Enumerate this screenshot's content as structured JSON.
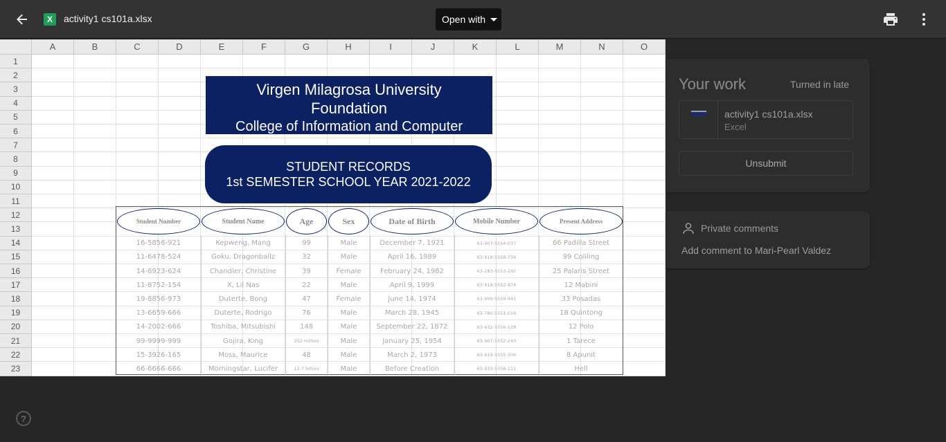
{
  "topbar": {
    "filename": "activity1 cs101a.xlsx",
    "file_badge": "X",
    "open_with_label": "Open with"
  },
  "sheet": {
    "columns": [
      "A",
      "B",
      "C",
      "D",
      "E",
      "F",
      "G",
      "H",
      "I",
      "J",
      "K",
      "L",
      "M",
      "N",
      "O"
    ],
    "rows": [
      "1",
      "2",
      "3",
      "4",
      "5",
      "6",
      "7",
      "8",
      "9",
      "10",
      "11",
      "12",
      "13",
      "14",
      "15",
      "16",
      "17",
      "18",
      "19",
      "20",
      "21",
      "22",
      "23"
    ],
    "banner1": {
      "line1": "Virgen Milagrosa University",
      "line2": "Foundation",
      "line3": "College of Information and Computer"
    },
    "banner2": {
      "line1": "STUDENT RECORDS",
      "line2": "1st SEMESTER SCHOOL YEAR 2021-2022"
    },
    "table": {
      "headers": [
        "Student Number",
        "Student Name",
        "Age",
        "Sex",
        "Date of Birth",
        "Mobile Number",
        "Present Address"
      ],
      "records": [
        [
          "16-5856-921",
          "Kepweng, Mang",
          "99",
          "Male",
          "December 7, 1921",
          "63-907-5554-037",
          "66 Padilla Street"
        ],
        [
          "11-6478-524",
          "Goku, Dragonballz",
          "32",
          "Male",
          "April 16, 1989",
          "63-919-5558-734",
          "99 Coliling"
        ],
        [
          "14-6923-624",
          "Chandler, Christine",
          "39",
          "Female",
          "February 24, 1982",
          "63-283-5553-292",
          "25 Palaris Street"
        ],
        [
          "11-8752-154",
          "X, Lil Nas",
          "22",
          "Male",
          "April 9, 1999",
          "63-919-5552-974",
          "12 Mabini"
        ],
        [
          "19-8856-973",
          "Duterte, Bong",
          "47",
          "Female",
          "June 14, 1974",
          "63-909-5559-941",
          "33 Posadas"
        ],
        [
          "13-6659-666",
          "Duterte, Rodrigo",
          "76",
          "Male",
          "March 28, 1945",
          "63-780-5551-016",
          "18 Quintong"
        ],
        [
          "14-2002-666",
          "Toshiba, Mitsubishi",
          "148",
          "Male",
          "September 22, 1872",
          "63-932-5556-128",
          "12 Polo"
        ],
        [
          "99-9999-999",
          "Gojira, King",
          "252 million",
          "Male",
          "January 25, 1954",
          "63-907-5552-240",
          "1 Tarece"
        ],
        [
          "15-3926-165",
          "Moss, Maurice",
          "48",
          "Male",
          "March 2, 1973",
          "63-919-5555-306",
          "8 Apunit"
        ],
        [
          "66-6666-666",
          "Morningstar, Lucifer",
          "13.7 billion",
          "Male",
          "Before Creation",
          "63-933-5558-111",
          "Hell"
        ]
      ]
    }
  },
  "panel": {
    "your_work": "Your work",
    "status": "Turned in late",
    "attachment_name": "activity1 cs101a.xlsx",
    "attachment_type": "Excel",
    "unsubmit_label": "Unsubmit",
    "private_comments": "Private comments",
    "add_comment": "Add comment to Mari-Pearl Valdez"
  },
  "help_label": "?"
}
